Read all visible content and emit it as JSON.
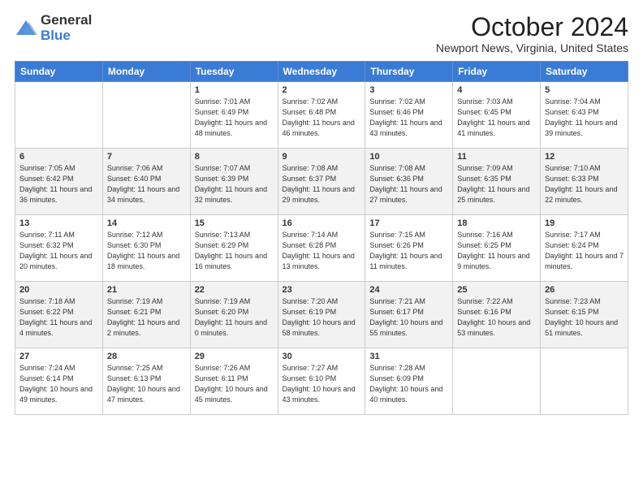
{
  "logo": {
    "general": "General",
    "blue": "Blue"
  },
  "title": "October 2024",
  "location": "Newport News, Virginia, United States",
  "days_of_week": [
    "Sunday",
    "Monday",
    "Tuesday",
    "Wednesday",
    "Thursday",
    "Friday",
    "Saturday"
  ],
  "weeks": [
    [
      {
        "day": "",
        "info": ""
      },
      {
        "day": "",
        "info": ""
      },
      {
        "day": "1",
        "info": "Sunrise: 7:01 AM\nSunset: 6:49 PM\nDaylight: 11 hours and 48 minutes."
      },
      {
        "day": "2",
        "info": "Sunrise: 7:02 AM\nSunset: 6:48 PM\nDaylight: 11 hours and 46 minutes."
      },
      {
        "day": "3",
        "info": "Sunrise: 7:02 AM\nSunset: 6:46 PM\nDaylight: 11 hours and 43 minutes."
      },
      {
        "day": "4",
        "info": "Sunrise: 7:03 AM\nSunset: 6:45 PM\nDaylight: 11 hours and 41 minutes."
      },
      {
        "day": "5",
        "info": "Sunrise: 7:04 AM\nSunset: 6:43 PM\nDaylight: 11 hours and 39 minutes."
      }
    ],
    [
      {
        "day": "6",
        "info": "Sunrise: 7:05 AM\nSunset: 6:42 PM\nDaylight: 11 hours and 36 minutes."
      },
      {
        "day": "7",
        "info": "Sunrise: 7:06 AM\nSunset: 6:40 PM\nDaylight: 11 hours and 34 minutes."
      },
      {
        "day": "8",
        "info": "Sunrise: 7:07 AM\nSunset: 6:39 PM\nDaylight: 11 hours and 32 minutes."
      },
      {
        "day": "9",
        "info": "Sunrise: 7:08 AM\nSunset: 6:37 PM\nDaylight: 11 hours and 29 minutes."
      },
      {
        "day": "10",
        "info": "Sunrise: 7:08 AM\nSunset: 6:36 PM\nDaylight: 11 hours and 27 minutes."
      },
      {
        "day": "11",
        "info": "Sunrise: 7:09 AM\nSunset: 6:35 PM\nDaylight: 11 hours and 25 minutes."
      },
      {
        "day": "12",
        "info": "Sunrise: 7:10 AM\nSunset: 6:33 PM\nDaylight: 11 hours and 22 minutes."
      }
    ],
    [
      {
        "day": "13",
        "info": "Sunrise: 7:11 AM\nSunset: 6:32 PM\nDaylight: 11 hours and 20 minutes."
      },
      {
        "day": "14",
        "info": "Sunrise: 7:12 AM\nSunset: 6:30 PM\nDaylight: 11 hours and 18 minutes."
      },
      {
        "day": "15",
        "info": "Sunrise: 7:13 AM\nSunset: 6:29 PM\nDaylight: 11 hours and 16 minutes."
      },
      {
        "day": "16",
        "info": "Sunrise: 7:14 AM\nSunset: 6:28 PM\nDaylight: 11 hours and 13 minutes."
      },
      {
        "day": "17",
        "info": "Sunrise: 7:15 AM\nSunset: 6:26 PM\nDaylight: 11 hours and 11 minutes."
      },
      {
        "day": "18",
        "info": "Sunrise: 7:16 AM\nSunset: 6:25 PM\nDaylight: 11 hours and 9 minutes."
      },
      {
        "day": "19",
        "info": "Sunrise: 7:17 AM\nSunset: 6:24 PM\nDaylight: 11 hours and 7 minutes."
      }
    ],
    [
      {
        "day": "20",
        "info": "Sunrise: 7:18 AM\nSunset: 6:22 PM\nDaylight: 11 hours and 4 minutes."
      },
      {
        "day": "21",
        "info": "Sunrise: 7:19 AM\nSunset: 6:21 PM\nDaylight: 11 hours and 2 minutes."
      },
      {
        "day": "22",
        "info": "Sunrise: 7:19 AM\nSunset: 6:20 PM\nDaylight: 11 hours and 0 minutes."
      },
      {
        "day": "23",
        "info": "Sunrise: 7:20 AM\nSunset: 6:19 PM\nDaylight: 10 hours and 58 minutes."
      },
      {
        "day": "24",
        "info": "Sunrise: 7:21 AM\nSunset: 6:17 PM\nDaylight: 10 hours and 55 minutes."
      },
      {
        "day": "25",
        "info": "Sunrise: 7:22 AM\nSunset: 6:16 PM\nDaylight: 10 hours and 53 minutes."
      },
      {
        "day": "26",
        "info": "Sunrise: 7:23 AM\nSunset: 6:15 PM\nDaylight: 10 hours and 51 minutes."
      }
    ],
    [
      {
        "day": "27",
        "info": "Sunrise: 7:24 AM\nSunset: 6:14 PM\nDaylight: 10 hours and 49 minutes."
      },
      {
        "day": "28",
        "info": "Sunrise: 7:25 AM\nSunset: 6:13 PM\nDaylight: 10 hours and 47 minutes."
      },
      {
        "day": "29",
        "info": "Sunrise: 7:26 AM\nSunset: 6:11 PM\nDaylight: 10 hours and 45 minutes."
      },
      {
        "day": "30",
        "info": "Sunrise: 7:27 AM\nSunset: 6:10 PM\nDaylight: 10 hours and 43 minutes."
      },
      {
        "day": "31",
        "info": "Sunrise: 7:28 AM\nSunset: 6:09 PM\nDaylight: 10 hours and 40 minutes."
      },
      {
        "day": "",
        "info": ""
      },
      {
        "day": "",
        "info": ""
      }
    ]
  ]
}
